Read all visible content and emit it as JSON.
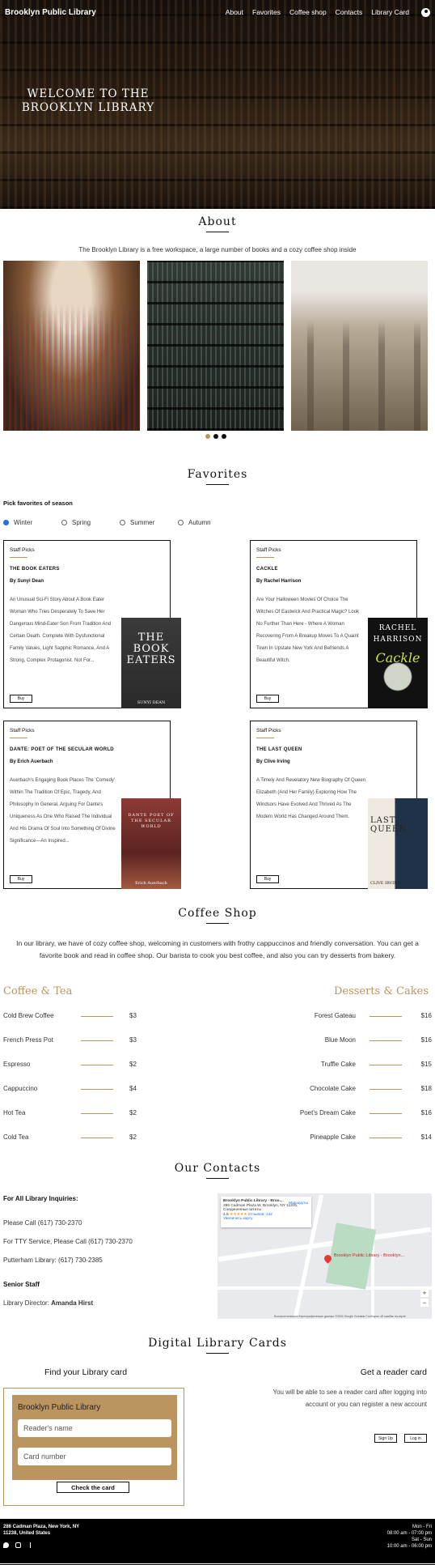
{
  "header": {
    "logo": "Brooklyn Public Library",
    "nav": [
      "About",
      "Favorites",
      "Coffee shop",
      "Contacts",
      "Library Card"
    ],
    "welcome": "WELCOME TO THE BROOKLYN LIBRARY"
  },
  "about": {
    "title": "About",
    "text": "The Brooklyn Library is a free workspace, a large number of books and a cozy coffee shop inside"
  },
  "favorites": {
    "title": "Favorites",
    "pick_label": "Pick favorites of season",
    "seasons": [
      "Winter",
      "Spring",
      "Summer",
      "Autumn"
    ],
    "selected_season": "Winter",
    "cards": [
      {
        "staff": "Staff Picks",
        "title": "THE BOOK EATERS",
        "author": "By Sunyi Dean",
        "description": "An Unusual Sci-Fi Story About A Book Eater Woman Who Tries Desperately To Save Her Dangerous Mind-Eater Son From Tradition And Certain Death. Complete With Dysfunctional Family Values, Light Sapphic Romance, And A Strong, Complex Protagonist. Not For...",
        "buy": "Buy",
        "cover_title": "THE BOOK EATERS",
        "cover_author": "SUNYI DEAN"
      },
      {
        "staff": "Staff Picks",
        "title": "CACKLE",
        "author": "By Rachel Harrison",
        "description": "Are Your Halloween Movies Of Choice The Witches Of Eastwick And Practical Magic? Look No Further Than Here - Where A Woman Recovering From A Breakup Moves To A Quaint Town In Upstate New York And Befriends A Beautiful Witch.",
        "buy": "Buy",
        "cover_title": "RACHEL HARRISON",
        "cover_author": "Cackle"
      },
      {
        "staff": "Staff Picks",
        "title": "DANTE: POET OF THE SECULAR WORLD",
        "author": "By Erich Auerbach",
        "description": "Auerbach's Engaging Book Places The 'Comedy' Within The Tradition Of Epic, Tragedy, And Philosophy In General, Arguing For Dante's Uniqueness As One Who Raised The Individual And His Drama Of Soul Into Something Of Divine Significance—An Inspired...",
        "buy": "Buy",
        "cover_title": "DANTE POET OF THE SECULAR WORLD",
        "cover_author": "Erich Auerbach"
      },
      {
        "staff": "Staff Picks",
        "title": "THE LAST QUEEN",
        "author": "By Clive Irving",
        "description": "A Timely And Revelatory New Biography Of Queen Elizabeth (And Her Family) Exploring How The Windsors Have Evolved And Thrived As The Modern World Has Changed Around Them.",
        "buy": "Buy",
        "cover_title": "LAST QUEEN",
        "cover_author": "CLIVE IRVING"
      }
    ]
  },
  "coffee": {
    "title": "Coffee Shop",
    "intro": "In our library, we have of cozy coffee shop, welcoming in customers with frothy cappuccinos and friendly conversation. You can get a favorite book and read in coffee shop. Our barista to cook you best coffee, and also you can try desserts from bakery.",
    "left_title": "Coffee & Tea",
    "right_title": "Desserts & Cakes",
    "left_items": [
      {
        "name": "Cold Brew Coffee",
        "price": "$3"
      },
      {
        "name": "French Press Pot",
        "price": "$3"
      },
      {
        "name": "Espresso",
        "price": "$2"
      },
      {
        "name": "Cappuccino",
        "price": "$4"
      },
      {
        "name": "Hot Tea",
        "price": "$2"
      },
      {
        "name": "Cold Tea",
        "price": "$2"
      }
    ],
    "right_items": [
      {
        "name": "Forest Gateau",
        "price": "$16"
      },
      {
        "name": "Blue Moon",
        "price": "$16"
      },
      {
        "name": "Truffle Cake",
        "price": "$15"
      },
      {
        "name": "Chocolate Cake",
        "price": "$18"
      },
      {
        "name": "Poet's Dream Cake",
        "price": "$16"
      },
      {
        "name": "Pineapple Cake",
        "price": "$14"
      }
    ]
  },
  "contacts": {
    "title": "Our Contacts",
    "heading": "For All Library Inquiries:",
    "phone": "Please Call (617) 730-2370",
    "tty": "For TTY Service, Please Call (617) 730-2370",
    "putterham": "Putterham Library: (617) 730-2385",
    "staff_heading": "Senior Staff",
    "director_label": "Library Director:",
    "director_name": "Amanda Hirst",
    "map": {
      "place": "Brooklyn Public Library - Broo...",
      "address": "286 Cadman Plaza W, Brooklyn, NY 11201, Соединенные Штаты",
      "rating": "4.5",
      "reviews": "Отзывов: 132",
      "bigger_map": "Увеличить карту",
      "directions": "Маршруты",
      "pin_label": "Brooklyn Public Library - Brooklyn...",
      "zoom_in": "+",
      "zoom_out": "−",
      "footer": "Быстрые клавиши   Картографические данные ©2024 Google   Условия   Сообщить об ошибке на карте"
    }
  },
  "cards": {
    "title": "Digital Library Cards",
    "find_title": "Find your Library card",
    "form_title": "Brooklyn Public Library",
    "name_placeholder": "Reader's name",
    "card_placeholder": "Card number",
    "check_button": "Check the card",
    "get_title": "Get a reader card",
    "get_text": "You will be able to see a reader card after logging into account or you can register a new account",
    "signup": "Sign Up",
    "login": "Log in"
  },
  "footer": {
    "address": "286 Cadman Plaza, New York, NY 11238, United States",
    "hours1": "Mon - Fri",
    "hours2": "08:00 am - 07:00 pm",
    "hours3": "Sat - Sun",
    "hours4": "10:00 am - 06:00 pm"
  }
}
